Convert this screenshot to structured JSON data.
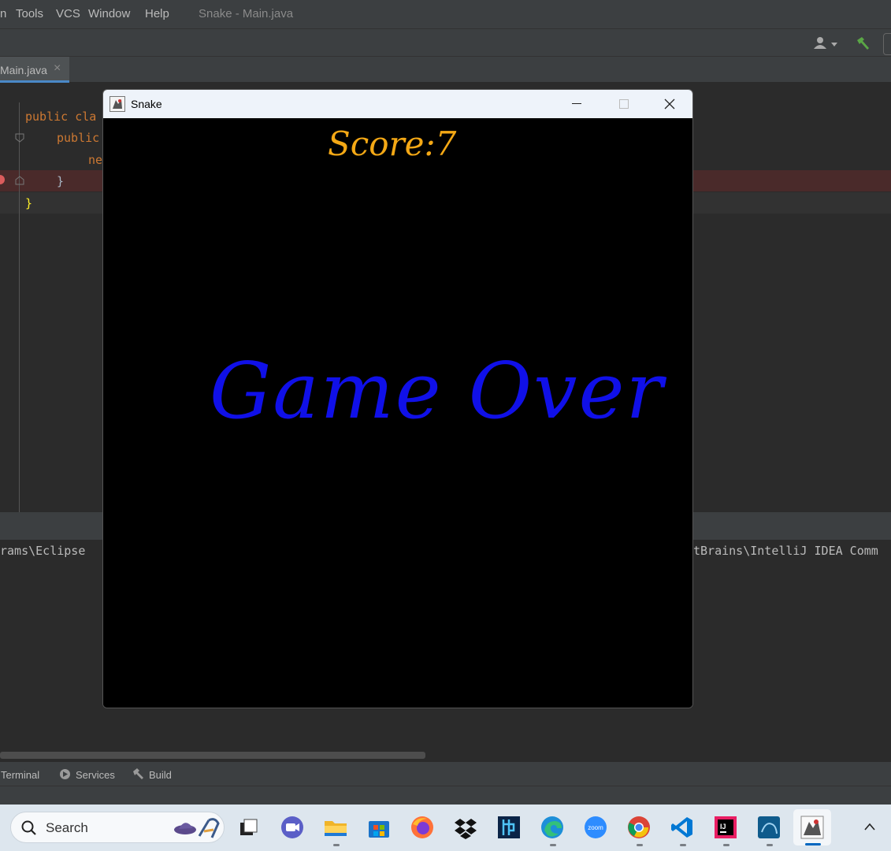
{
  "menu": {
    "partial": "n",
    "tools": "Tools",
    "vcs": "VCS",
    "window": "Window",
    "help": "Help",
    "title": "Snake - Main.java"
  },
  "editor_tab": {
    "label": "Main.java",
    "close": "×"
  },
  "code": {
    "line1": "public cla",
    "line2": "public",
    "line3": "ne",
    "line4": "}",
    "line5": "}"
  },
  "console": {
    "left_text": "rams\\Eclipse ",
    "right_text": "tBrains\\IntelliJ IDEA Comm"
  },
  "bottom_tools": {
    "terminal": "Terminal",
    "services": "Services",
    "build": "Build"
  },
  "game": {
    "title": "Snake",
    "score_text": "Score:7",
    "message": "Game Over",
    "colors": {
      "score": "#f4a815",
      "message": "#1010e8",
      "background": "#000000"
    }
  },
  "taskbar": {
    "search_placeholder": "Search",
    "icons": [
      "task-view-icon",
      "teams-chat-icon",
      "file-explorer-icon",
      "microsoft-store-icon",
      "firefox-icon",
      "dropbox-icon",
      "app-icon",
      "edge-icon",
      "zoom-icon",
      "chrome-icon",
      "vscode-icon",
      "intellij-icon",
      "mysql-workbench-icon",
      "java-app-icon"
    ],
    "zoom_label": "zoom",
    "ij_label": "IJ"
  }
}
